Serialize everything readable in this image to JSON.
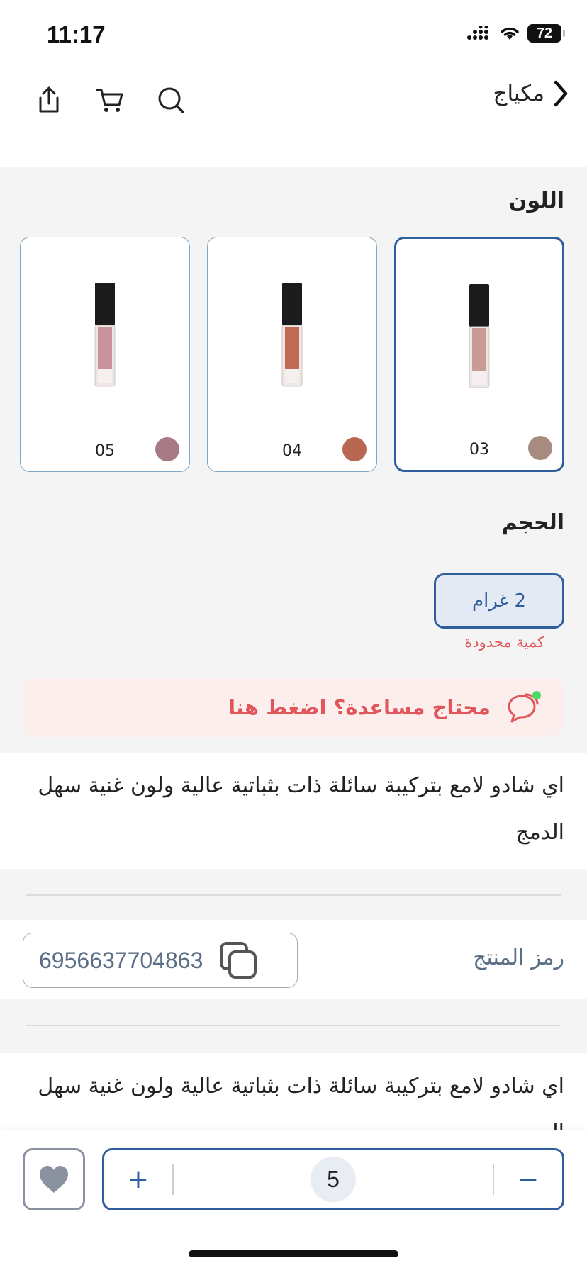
{
  "status": {
    "time": "11:17",
    "battery": "72"
  },
  "nav": {
    "title": "مكياج"
  },
  "color_section": {
    "title": "اللون",
    "options": [
      {
        "code": "03",
        "dot_color": "#a88a7f",
        "selected": true
      },
      {
        "code": "04",
        "dot_color": "#b86753",
        "selected": false
      },
      {
        "code": "05",
        "dot_color": "#a87a85",
        "selected": false
      }
    ]
  },
  "size_section": {
    "title": "الحجم",
    "option": "2 غرام",
    "note": "كمية محدودة"
  },
  "help": {
    "text": "محتاج مساعدة؟ اضغط هنا"
  },
  "description": "اي شادو لامع بتركيبة سائلة ذات بثباتية عالية ولون غنية سهل الدمج",
  "sku": {
    "label": "رمز المنتج",
    "value": "6956637704863"
  },
  "quantity": {
    "value": "5",
    "plus": "+",
    "minus": "−"
  },
  "colors": {
    "accent": "#2f5f9e",
    "alert": "#e0565b"
  }
}
